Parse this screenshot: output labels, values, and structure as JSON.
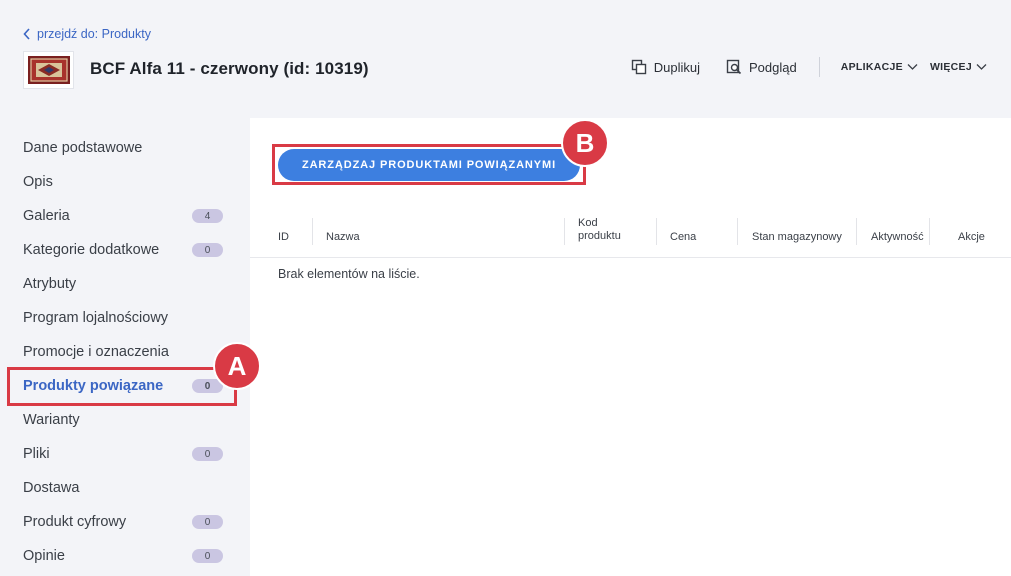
{
  "header": {
    "back_link": "przejdź do: Produkty",
    "title": "BCF Alfa 11 - czerwony (id: 10319)",
    "actions": {
      "duplicate": "Duplikuj",
      "preview": "Podgląd"
    },
    "menus": {
      "apps": "APLIKACJE",
      "more": "WIĘCEJ"
    }
  },
  "sidebar": {
    "items": [
      {
        "label": "Dane podstawowe",
        "badge": null
      },
      {
        "label": "Opis",
        "badge": null
      },
      {
        "label": "Galeria",
        "badge": "4"
      },
      {
        "label": "Kategorie dodatkowe",
        "badge": "0"
      },
      {
        "label": "Atrybuty",
        "badge": null
      },
      {
        "label": "Program lojalnościowy",
        "badge": null
      },
      {
        "label": "Promocje i oznaczenia",
        "badge": null
      },
      {
        "label": "Produkty powiązane",
        "badge": "0",
        "active": true
      },
      {
        "label": "Warianty",
        "badge": null
      },
      {
        "label": "Pliki",
        "badge": "0"
      },
      {
        "label": "Dostawa",
        "badge": null
      },
      {
        "label": "Produkt cyfrowy",
        "badge": "0"
      },
      {
        "label": "Opinie",
        "badge": "0"
      }
    ]
  },
  "main": {
    "manage_button": "ZARZĄDZAJ PRODUKTAMI POWIĄZANYMI",
    "columns": {
      "id": "ID",
      "name": "Nazwa",
      "code_line1": "Kod",
      "code_line2": "produktu",
      "price": "Cena",
      "stock": "Stan magazynowy",
      "active": "Aktywność",
      "actions": "Akcje"
    },
    "empty_message": "Brak elementów na liście."
  },
  "annotations": {
    "marker_a": "A",
    "marker_b": "B"
  },
  "colors": {
    "accent": "#3d7fe0",
    "link": "#3b66c4",
    "highlight": "#d93a45",
    "badge": "#cac6e2",
    "sidebar_bg": "#f3f4f8"
  }
}
